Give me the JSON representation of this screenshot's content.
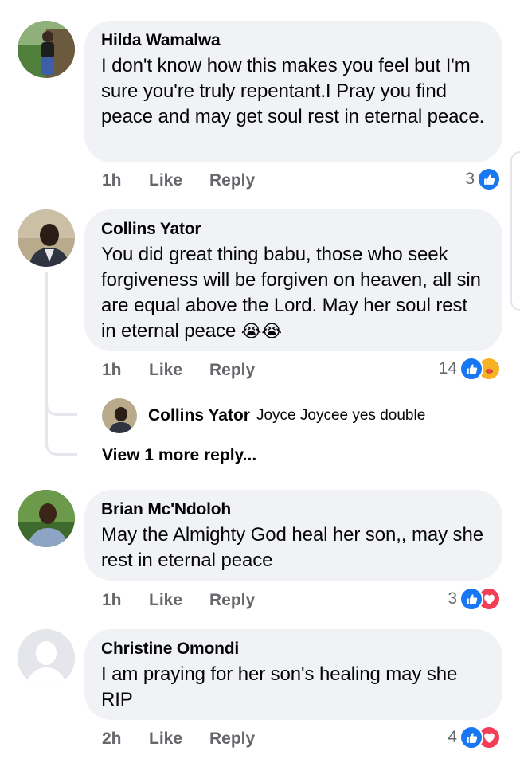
{
  "comments": [
    {
      "author": "Hilda Wamalwa",
      "text": "I don't know how this makes you feel but I'm sure you're truly repentant.I Pray you find peace and may get soul rest in eternal peace.",
      "time": "1h",
      "like_label": "Like",
      "reply_label": "Reply",
      "reaction_count": "3",
      "reactions": [
        "like-icon"
      ]
    },
    {
      "author": "Collins Yator",
      "text": "You did great thing babu, those who seek forgiveness will be forgiven on heaven, all sin are equal above the Lord. May her soul rest in eternal peace",
      "emoji": "😭😭",
      "time": "1h",
      "like_label": "Like",
      "reply_label": "Reply",
      "reaction_count": "14",
      "reactions": [
        "like-icon",
        "care-icon"
      ],
      "reply": {
        "author": "Collins Yator",
        "text": "Joyce Joycee yes double"
      },
      "view_more": "View 1 more reply..."
    },
    {
      "author": "Brian Mc'Ndoloh",
      "text": "May the Almighty God heal her son,, may she rest in eternal peace",
      "time": "1h",
      "like_label": "Like",
      "reply_label": "Reply",
      "reaction_count": "3",
      "reactions": [
        "like-icon",
        "love-icon"
      ]
    },
    {
      "author": "Christine Omondi",
      "text": "I am praying for her son's healing may she RIP",
      "time": "2h",
      "like_label": "Like",
      "reply_label": "Reply",
      "reaction_count": "4",
      "reactions": [
        "like-icon",
        "love-icon"
      ]
    }
  ],
  "colors": {
    "bubble": "#f0f2f5",
    "meta_text": "#65676b",
    "like_blue": "#1877f2",
    "love_red": "#f33e58"
  }
}
